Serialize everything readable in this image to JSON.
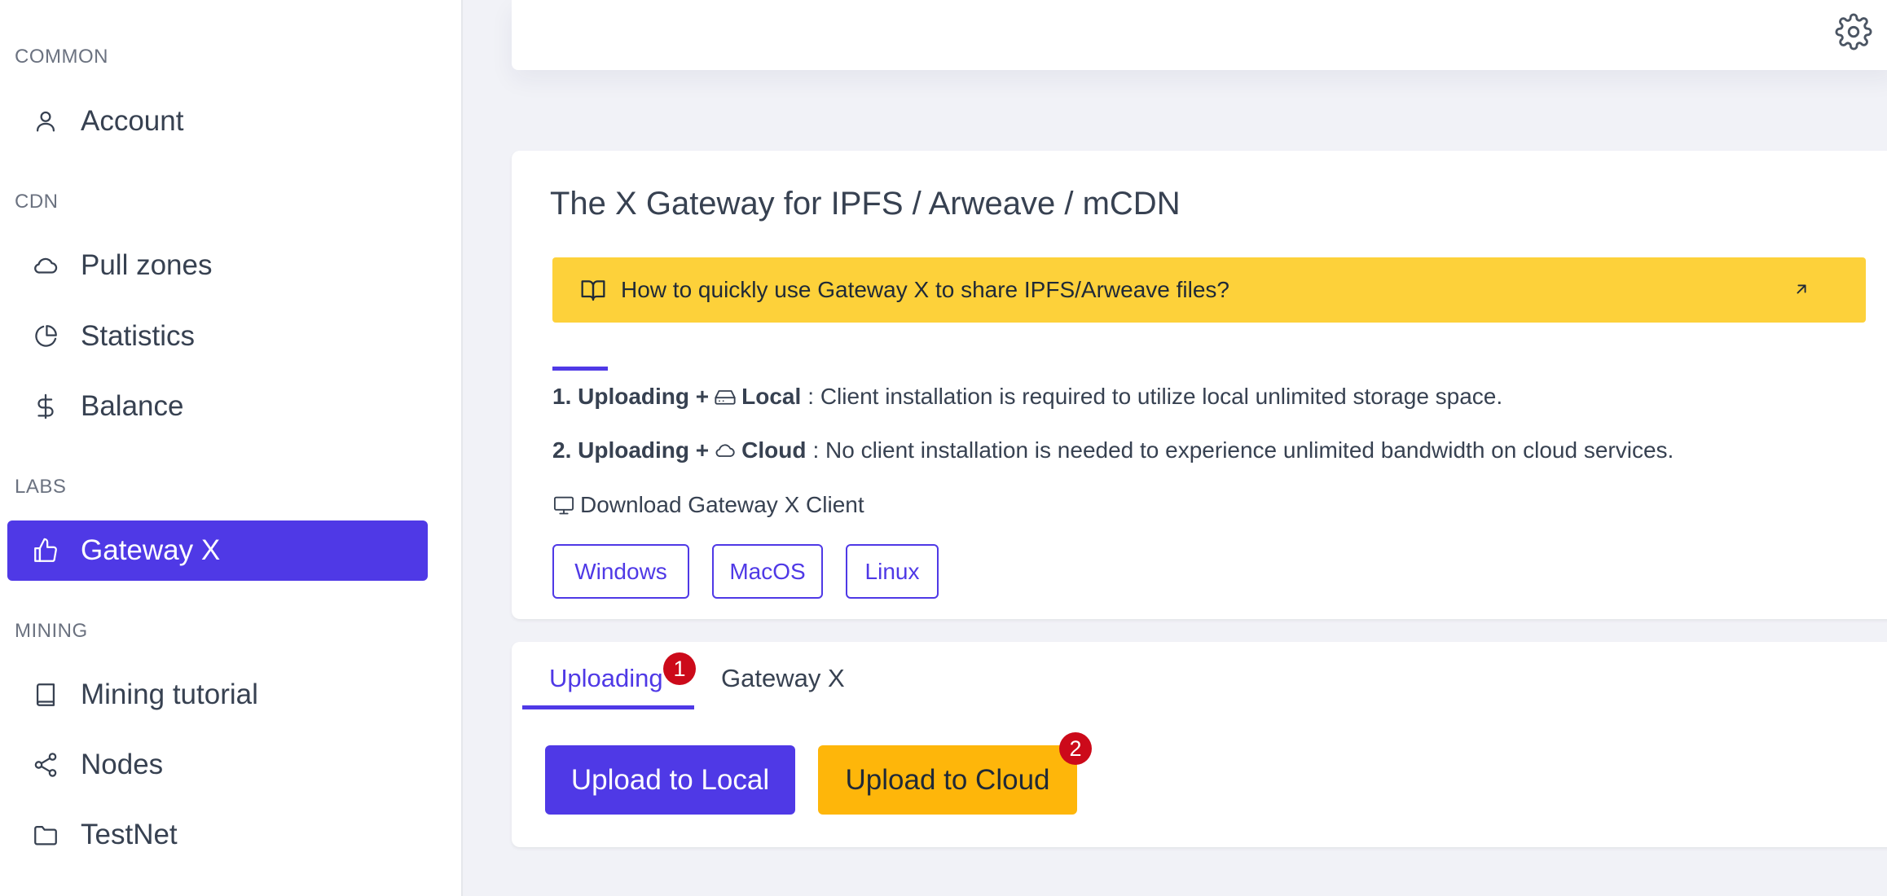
{
  "sidebar": {
    "sections": [
      {
        "label": "COMMON"
      },
      {
        "label": "CDN"
      },
      {
        "label": "LABS"
      },
      {
        "label": "MINING"
      }
    ],
    "items": [
      {
        "label": "Account",
        "icon": "user-icon"
      },
      {
        "label": "Pull zones",
        "icon": "cloud-icon"
      },
      {
        "label": "Statistics",
        "icon": "pie-chart-icon"
      },
      {
        "label": "Balance",
        "icon": "dollar-icon"
      },
      {
        "label": "Gateway X",
        "icon": "thumbs-up-icon",
        "active": true
      },
      {
        "label": "Mining tutorial",
        "icon": "book-icon"
      },
      {
        "label": "Nodes",
        "icon": "share-icon"
      },
      {
        "label": "TestNet",
        "icon": "folder-icon"
      }
    ]
  },
  "header": {
    "settings_icon": "gear-icon"
  },
  "main": {
    "title": "The X Gateway for IPFS / Arweave / mCDN",
    "alert": {
      "text": "How to quickly use Gateway X to share IPFS/Arweave files?",
      "icon": "book-open-icon",
      "color": "#fdd13a"
    },
    "info": [
      {
        "prefix": "1. Uploading +",
        "mode": "Local",
        "rest": ": Client installation is required to utilize local unlimited storage space."
      },
      {
        "prefix": "2. Uploading +",
        "mode": "Cloud",
        "rest": ": No client installation is needed to experience unlimited bandwidth on cloud services."
      }
    ],
    "download_label": "Download Gateway X Client",
    "os_buttons": [
      "Windows",
      "MacOS",
      "Linux"
    ],
    "tabs": [
      {
        "label": "Uploading",
        "badge": "1",
        "active": true
      },
      {
        "label": "Gateway X"
      }
    ],
    "upload_local_label": "Upload to Local",
    "upload_cloud_label": "Upload to Cloud",
    "upload_cloud_badge": "2"
  },
  "colors": {
    "accent": "#4f39e6",
    "warning": "#fdd13a",
    "cloud_button": "#feb60a",
    "badge": "#cc0a1a"
  }
}
